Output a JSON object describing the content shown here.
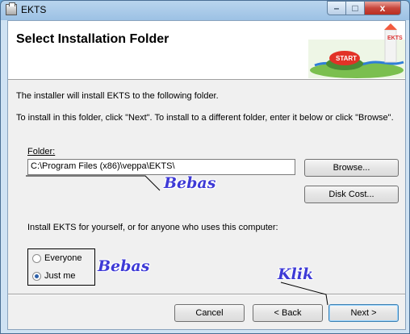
{
  "window": {
    "title": "EKTS",
    "min_glyph": "–",
    "max_glyph": "□",
    "close_glyph": "x"
  },
  "header": {
    "title": "Select Installation Folder",
    "logo_text": "START",
    "logo_label": "EKTS"
  },
  "body": {
    "line1": "The installer will install EKTS to the following folder.",
    "line2": "To install in this folder, click \"Next\". To install to a different folder, enter it below or click \"Browse\".",
    "folder_label": "Folder:",
    "folder_value": "C:\\Program Files (x86)\\veppa\\EKTS\\",
    "browse_label": "Browse...",
    "disk_cost_label": "Disk Cost...",
    "install_for_label": "Install EKTS for yourself, or for anyone who uses this computer:",
    "radio_options": [
      {
        "label": "Everyone",
        "checked": false
      },
      {
        "label": "Just me",
        "checked": true
      }
    ]
  },
  "footer": {
    "cancel_label": "Cancel",
    "back_label": "< Back",
    "next_label": "Next >"
  },
  "annotations": {
    "bebas_folder": "Bebas",
    "bebas_radio": "Bebas",
    "klik": "Klik",
    "color": "#3e3ad6"
  }
}
